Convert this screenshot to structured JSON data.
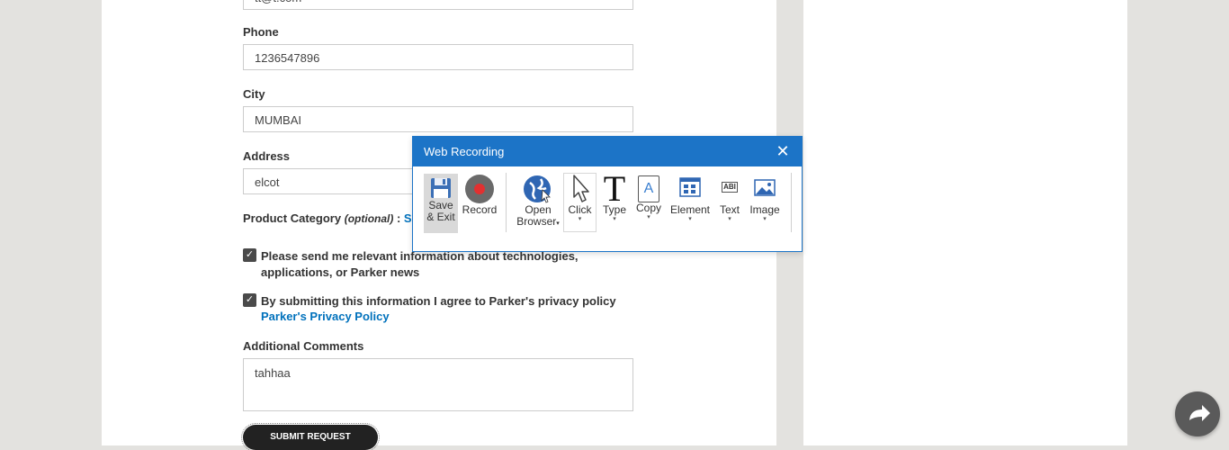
{
  "form": {
    "email_value": "tt@t.com",
    "phone_label": "Phone",
    "phone_value": "1236547896",
    "city_label": "City",
    "city_value": "MUMBAI",
    "address_label": "Address",
    "address_value": "elcot",
    "product_category_label": "Product Category",
    "product_category_optional": "(optional)",
    "product_category_colon": " : ",
    "product_category_link": "Sele",
    "consent1_text": "Please send me relevant information about technologies, applications, or Parker news",
    "consent2_text": "By submitting this information I agree to Parker's privacy policy",
    "privacy_link": "Parker's Privacy Policy",
    "comments_label": "Additional Comments",
    "comments_value": "tahhaa",
    "submit_label": "SUBMIT REQUEST",
    "check_glyph": "✓"
  },
  "dialog": {
    "title": "Web Recording",
    "close_glyph": "✕",
    "dropdown_glyph": "▾",
    "tools": {
      "save_line1": "Save",
      "save_line2": "& Exit",
      "record": "Record",
      "open_line1": "Open",
      "open_line2": "Browser",
      "click": "Click",
      "type": "Type",
      "type_glyph": "T",
      "copy": "Copy",
      "copy_glyph": "A",
      "element": "Element",
      "text": "Text",
      "text_glyph": "ABI",
      "image": "Image"
    }
  },
  "colors": {
    "dialog_accent": "#1c74c7",
    "link": "#0071bc",
    "record_red": "#e23030"
  },
  "icons": {
    "share": "share-arrow-icon"
  }
}
